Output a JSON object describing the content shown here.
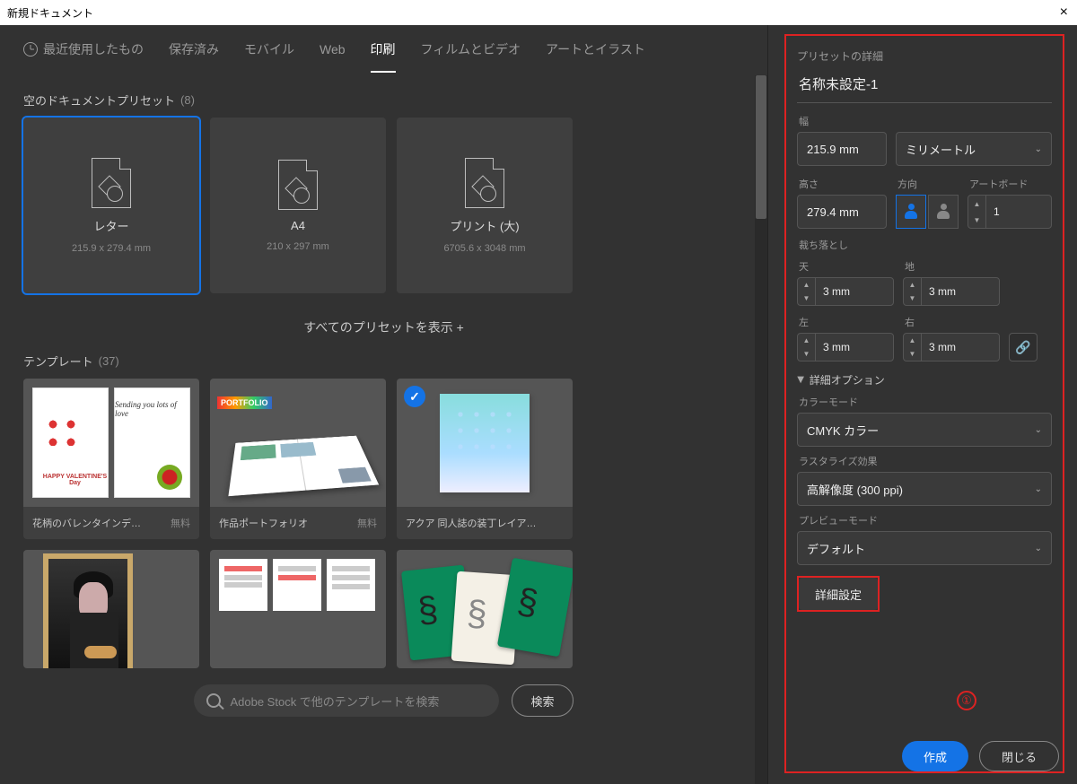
{
  "window": {
    "title": "新規ドキュメント"
  },
  "tabs": {
    "recent": "最近使用したもの",
    "saved": "保存済み",
    "mobile": "モバイル",
    "web": "Web",
    "print": "印刷",
    "film": "フィルムとビデオ",
    "art": "アートとイラスト"
  },
  "sections": {
    "blank": {
      "label": "空のドキュメントプリセット",
      "count": "(8)"
    },
    "show_all": "すべてのプリセットを表示 +",
    "templates": {
      "label": "テンプレート",
      "count": "(37)"
    }
  },
  "presets": [
    {
      "name": "レター",
      "size": "215.9 x 279.4 mm",
      "selected": true
    },
    {
      "name": "A4",
      "size": "210 x 297 mm",
      "selected": false
    },
    {
      "name": "プリント (大)",
      "size": "6705.6 x 3048 mm",
      "selected": false
    }
  ],
  "templates": [
    {
      "name": "花柄のバレンタインデ…",
      "price": "無料"
    },
    {
      "name": "作品ポートフォリオ",
      "price": "無料"
    },
    {
      "name": "アクア 同人誌の装丁レイア…",
      "price": "",
      "checked": true
    },
    {
      "name": "",
      "price": ""
    },
    {
      "name": "",
      "price": ""
    },
    {
      "name": "",
      "price": ""
    }
  ],
  "thumb1": {
    "script": "Sending you\nlots of love",
    "hv": "HAPPY VALENTINE'S\nDay"
  },
  "thumb2": {
    "port": "PORTFOLIO"
  },
  "search": {
    "placeholder": "Adobe Stock で他のテンプレートを検索",
    "button": "検索"
  },
  "panel": {
    "title": "プリセットの詳細",
    "doc_name": "名称未設定-1",
    "width_label": "幅",
    "width_value": "215.9 mm",
    "units": "ミリメートル",
    "height_label": "高さ",
    "height_value": "279.4 mm",
    "orient_label": "方向",
    "artboard_label": "アートボード",
    "artboard_value": "1",
    "bleed_label": "裁ち落とし",
    "top_label": "天",
    "bottom_label": "地",
    "left_label": "左",
    "right_label": "右",
    "bleed_value": "3 mm",
    "advanced": "詳細オプション",
    "color_label": "カラーモード",
    "color_value": "CMYK カラー",
    "raster_label": "ラスタライズ効果",
    "raster_value": "高解像度 (300 ppi)",
    "preview_label": "プレビューモード",
    "preview_value": "デフォルト",
    "more_settings": "詳細設定",
    "annotation": "①"
  },
  "footer": {
    "create": "作成",
    "close": "閉じる"
  }
}
